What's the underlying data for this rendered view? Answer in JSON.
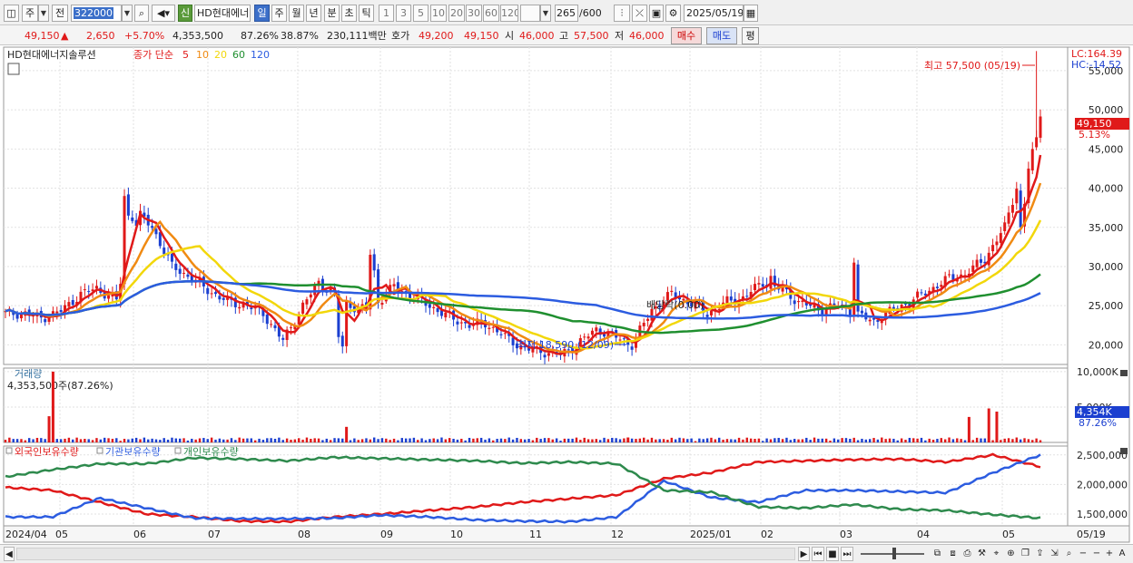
{
  "toolbar": {
    "type_label": "주",
    "prev_label": "전",
    "code": "322000",
    "sin_label": "신",
    "stock_name": "HD현대에너",
    "period_tabs": [
      "일",
      "주",
      "월",
      "년",
      "분",
      "초",
      "틱"
    ],
    "interval_tabs": [
      "1",
      "3",
      "5",
      "10",
      "20",
      "30",
      "60",
      "120"
    ],
    "count": "265",
    "count_total": "/600",
    "date": "2025/05/19"
  },
  "quote": {
    "price": "49,150",
    "change": "2,650",
    "change_pct": "+5.70%",
    "volume": "4,353,500",
    "vol_ratio": "87.26%",
    "turnover": "38.87%",
    "amount": "230,111백만",
    "hoga_label": "호가",
    "ask": "49,200",
    "bid": "49,150",
    "open_label": "시",
    "open": "46,000",
    "high_label": "고",
    "high": "57,500",
    "low_label": "저",
    "low": "46,000",
    "buy_label": "매수",
    "sell_label": "매도",
    "eval_label": "평"
  },
  "chart_data": [
    {
      "type": "candlestick",
      "title": "HD현대에너지솔루션",
      "legend": {
        "name": "종가 단순",
        "periods": [
          "5",
          "10",
          "20",
          "60",
          "120"
        ],
        "colors": [
          "#e01919",
          "#f08a12",
          "#f2d70a",
          "#1f8f2f",
          "#2c5ce0"
        ]
      },
      "ylim": [
        17500,
        58000
      ],
      "yticks": [
        "55,000",
        "50,000",
        "45,000",
        "40,000",
        "35,000",
        "30,000",
        "25,000",
        "20,000"
      ],
      "annotations": {
        "high": "최고 57,500 (05/19)",
        "low": "최저 18,590 (12/09)",
        "dividend": "배당락(0.00)",
        "lc": "LC:164.39",
        "hc": "HC:-14.52",
        "current_price": "49,150",
        "current_pct": "5.13%"
      },
      "series_close_anchors": [
        24000,
        24000,
        23400,
        24300,
        26500,
        27200,
        25700,
        37000,
        35000,
        30000,
        28500,
        27000,
        25500,
        25000,
        24000,
        20500,
        25000,
        28000,
        26000,
        24500,
        25000,
        27500,
        26000,
        25000,
        23500,
        22500,
        22800,
        21000,
        19500,
        19200,
        18700,
        20000,
        22000,
        21000,
        20000,
        24500,
        26500,
        25500,
        24000,
        25500,
        26000,
        28000,
        27000,
        25500,
        24500,
        25000,
        24000,
        23000,
        24500,
        25500,
        27000,
        28500,
        29000,
        31000,
        35000,
        42000,
        49150
      ],
      "x_anchor_index": [
        0,
        4,
        8,
        12,
        17,
        22,
        26,
        31,
        36,
        42,
        46,
        51,
        56
      ],
      "xticks": [
        "2024/04",
        "05",
        "06",
        "07",
        "08",
        "09",
        "10",
        "11",
        "12",
        "2025/01",
        "02",
        "03",
        "04",
        "05",
        "05/19"
      ]
    },
    {
      "type": "bar",
      "title": "거래량",
      "value_label": "4,353,500주(87.26%)",
      "yticks": [
        "10,000K",
        "5,000K"
      ],
      "current": "4,354K",
      "current_pct": "87.26%",
      "ylim": [
        0,
        10500
      ],
      "spikes": [
        {
          "x": 12,
          "value": 10000
        },
        {
          "x": 11,
          "value": 3700
        },
        {
          "x": 86,
          "value": 2200
        },
        {
          "x": 157,
          "value": 700
        },
        {
          "x": 243,
          "value": 3600
        },
        {
          "x": 248,
          "value": 4800
        },
        {
          "x": 250,
          "value": 4354
        }
      ]
    },
    {
      "type": "line",
      "legend": [
        "외국인보유수량",
        "기관보유수량",
        "개인보유수량"
      ],
      "colors": [
        "#e01919",
        "#2c5ce0",
        "#2e8a4d"
      ],
      "yticks": [
        "2,500,000",
        "2,000,000",
        "1,500,000"
      ],
      "ylim": [
        1300000,
        2650000
      ],
      "foreign": [
        1950000,
        1900000,
        1700000,
        1500000,
        1450000,
        1380000,
        1370000,
        1450000,
        1500000,
        1560000,
        1620000,
        1700000,
        1760000,
        1820000,
        2100000,
        2200000,
        2380000,
        2400000,
        2420000,
        2430000,
        2380000,
        2500000,
        2300000
      ],
      "institution": [
        1450000,
        1450000,
        1770000,
        1600000,
        1430000,
        1420000,
        1420000,
        1430000,
        1480000,
        1450000,
        1400000,
        1380000,
        1370000,
        1450000,
        2060000,
        1780000,
        1700000,
        1900000,
        1900000,
        1880000,
        1860000,
        2200000,
        2500000
      ],
      "individual": [
        2130000,
        2250000,
        2350000,
        2350000,
        2450000,
        2430000,
        2400000,
        2460000,
        2440000,
        2420000,
        2400000,
        2360000,
        2380000,
        2350000,
        1900000,
        1870000,
        1620000,
        1600000,
        1660000,
        1580000,
        1560000,
        1490000,
        1430000
      ]
    }
  ],
  "status": {
    "nav_buttons": [
      "▶",
      "⏮",
      "■",
      "⏭"
    ]
  }
}
